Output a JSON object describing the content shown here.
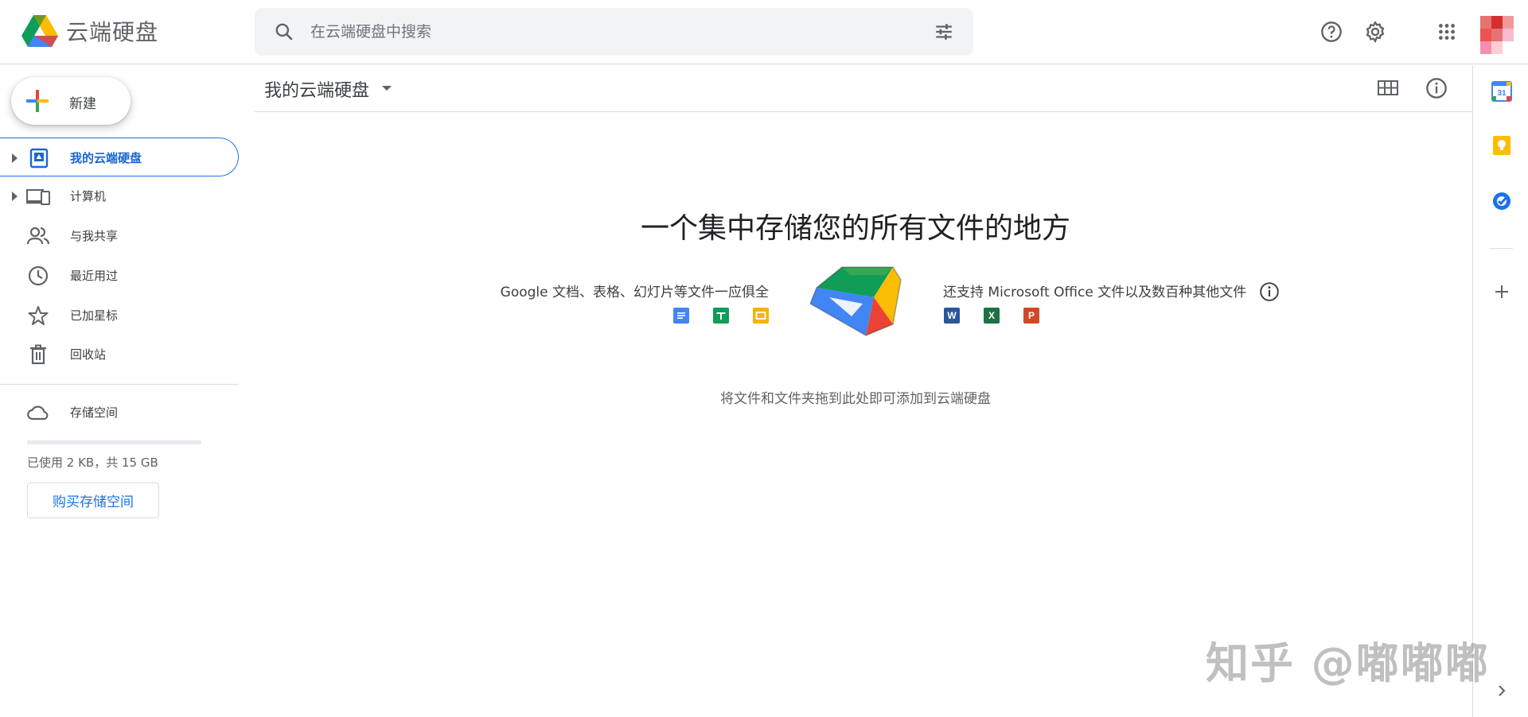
{
  "app": {
    "title": "云端硬盘",
    "logo_icon": "google-drive-logo"
  },
  "search": {
    "placeholder": "在云端硬盘中搜索",
    "value": ""
  },
  "header_icons": [
    "help-icon",
    "settings-icon",
    "apps-grid-icon",
    "account-avatar"
  ],
  "new_button": {
    "label": "新建"
  },
  "sidebar": {
    "items": [
      {
        "label": "我的云端硬盘",
        "icon": "my-drive-icon",
        "active": true,
        "expandable": true
      },
      {
        "label": "计算机",
        "icon": "computers-icon",
        "active": false,
        "expandable": true
      },
      {
        "label": "与我共享",
        "icon": "shared-with-me-icon",
        "active": false,
        "expandable": false
      },
      {
        "label": "最近用过",
        "icon": "clock-icon",
        "active": false,
        "expandable": false
      },
      {
        "label": "已加星标",
        "icon": "star-icon",
        "active": false,
        "expandable": false
      },
      {
        "label": "回收站",
        "icon": "trash-icon",
        "active": false,
        "expandable": false
      }
    ],
    "storage": {
      "label": "存储空间",
      "usage_text": "已使用 2 KB，共 15 GB",
      "used_fraction": 0.0001,
      "buy_label": "购买存储空间"
    }
  },
  "main": {
    "title": "我的云端硬盘",
    "headline": "一个集中存储您的所有文件的地方",
    "left_text": "Google 文档、表格、幻灯片等文件一应俱全",
    "right_text": "还支持 Microsoft Office 文件以及数百种其他文件",
    "office_icons": {
      "word": "W",
      "excel": "X",
      "powerpoint": "P"
    },
    "drop_text": "将文件和文件夹拖到此处即可添加到云端硬盘"
  },
  "right_panel": {
    "calendar_day": "31",
    "icons": [
      "calendar-icon",
      "keep-icon",
      "tasks-icon",
      "add-addon-icon",
      "hide-panel-icon"
    ]
  },
  "watermark": "知乎 @嘟嘟嘟",
  "colors": {
    "accent_blue": "#1a73e8",
    "active_text": "#1967d2",
    "border": "#dadce0",
    "search_bg": "#f1f3f4",
    "docs_blue": "#4285f4",
    "sheets_green": "#0f9d58",
    "slides_yellow": "#f4b400",
    "word_blue": "#2b579a",
    "excel_green": "#1e7145",
    "ppt_orange": "#d24726"
  }
}
